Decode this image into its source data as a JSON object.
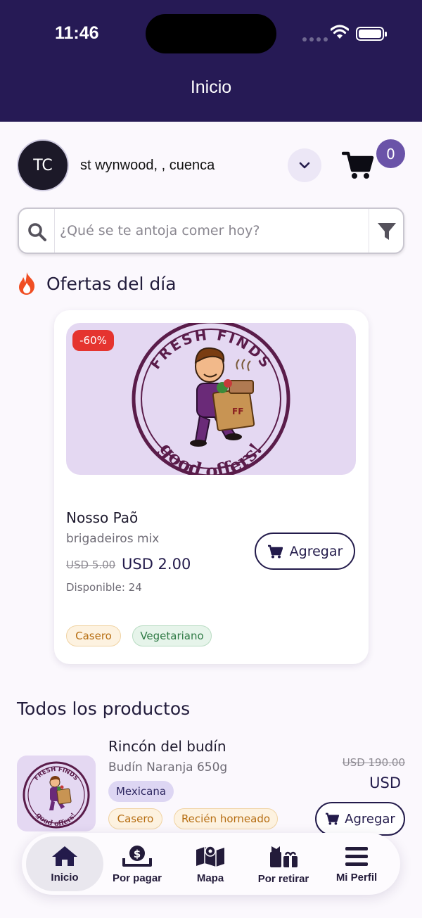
{
  "status_bar": {
    "time": "11:46"
  },
  "header": {
    "title": "Inicio"
  },
  "user": {
    "initials": "TC",
    "location": "st wynwood, , cuenca"
  },
  "cart": {
    "count": "0"
  },
  "search": {
    "placeholder": "¿Qué se te antoja comer hoy?"
  },
  "offers_section": {
    "title": "Ofertas del día",
    "item": {
      "discount": "-60%",
      "name": "Nosso Paõ",
      "description": "brigadeiros mix",
      "old_price": "USD 5.00",
      "price": "USD 2.00",
      "available": "Disponible: 24",
      "add_label": "Agregar",
      "tags": [
        "Casero",
        "Vegetariano"
      ]
    }
  },
  "products_section": {
    "title": "Todos los productos",
    "item": {
      "name": "Rincón del budín",
      "description": "Budín Naranja 650g",
      "category": "Mexicana",
      "tags": [
        "Casero",
        "Recién horneado"
      ],
      "old_price": "USD 190.00",
      "price": "USD",
      "add_label": "Agregar"
    }
  },
  "logo": {
    "top_text": "FRESH FINDS",
    "bottom_text": "good offers!",
    "bag_text": "FF"
  },
  "bottom_nav": [
    {
      "label": "Inicio",
      "icon": "home-icon",
      "active": true
    },
    {
      "label": "Por pagar",
      "icon": "dollar-tray-icon"
    },
    {
      "label": "Mapa",
      "icon": "map-icon"
    },
    {
      "label": "Por retirar",
      "icon": "gift-icon"
    },
    {
      "label": "Mi Perfil",
      "icon": "menu-icon"
    }
  ],
  "colors": {
    "header": "#261a55",
    "accent": "#6a53a8",
    "discount": "#e5342f",
    "primary_text": "#231b4b"
  }
}
